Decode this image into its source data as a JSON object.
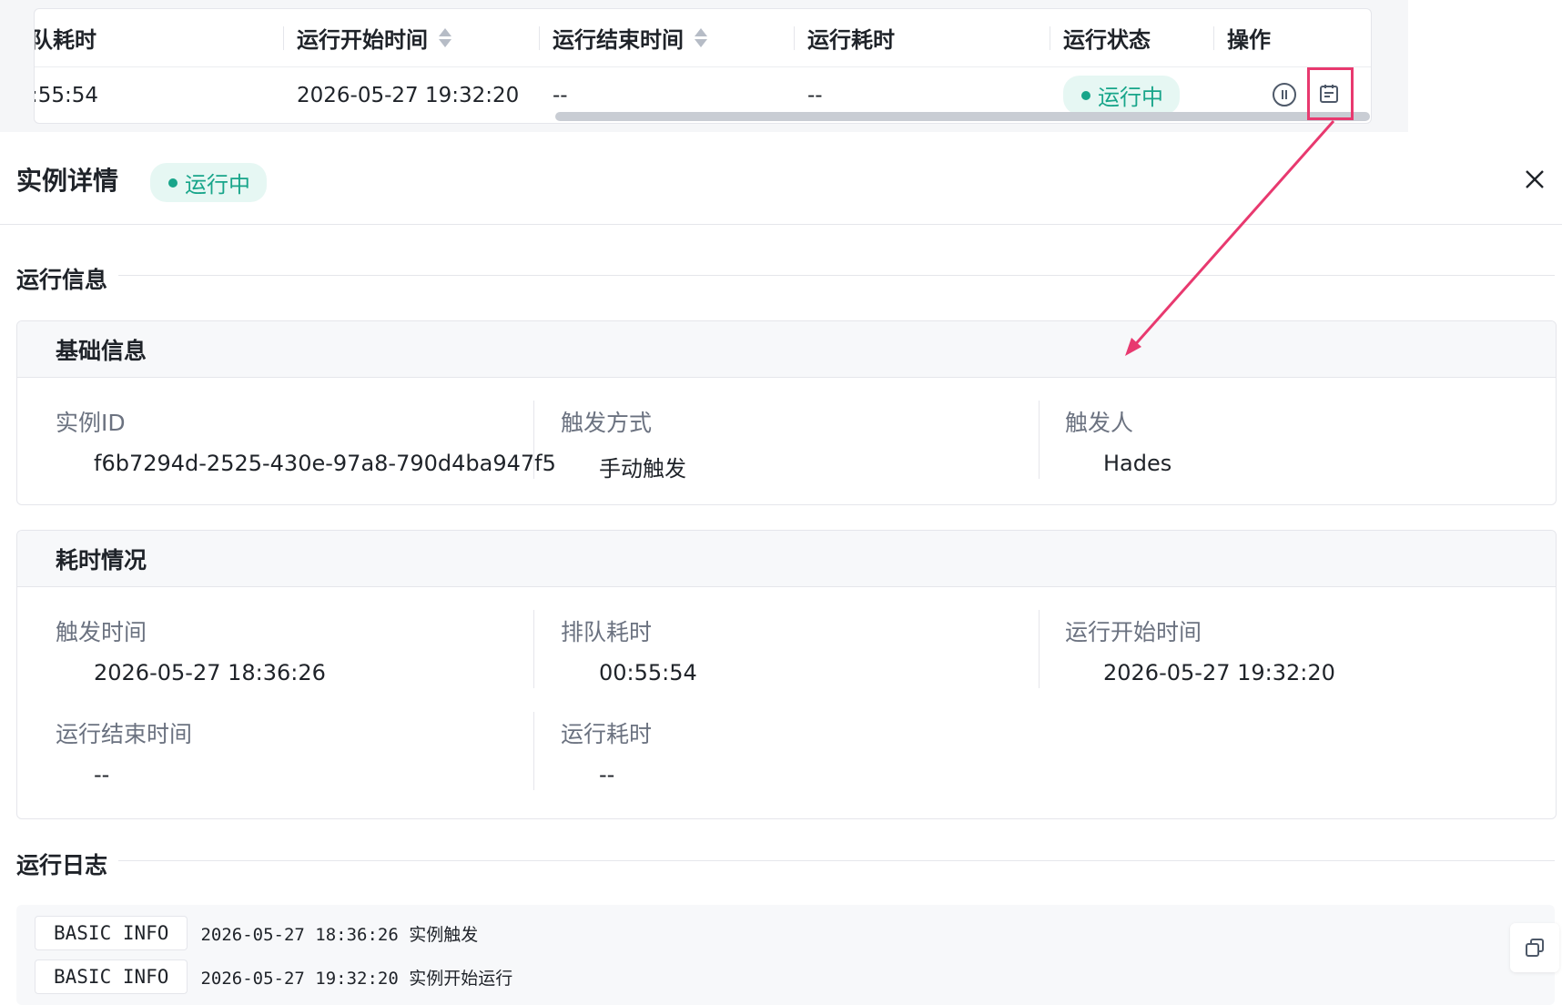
{
  "table": {
    "headers": {
      "queue_time": "队耗时",
      "run_start_time": "运行开始时间",
      "run_end_time": "运行结束时间",
      "run_duration": "运行耗时",
      "run_status": "运行状态",
      "actions": "操作"
    },
    "row": {
      "queue_time": ":55:54",
      "run_start_time": "2026-05-27 19:32:20",
      "run_end_time": "--",
      "run_duration": "--",
      "run_status": "运行中"
    },
    "action_icons": [
      "pause-icon",
      "detail-icon"
    ]
  },
  "drawer": {
    "title": "实例详情",
    "status": "运行中",
    "run_info_title": "运行信息",
    "basic": {
      "title": "基础信息",
      "instance_id_label": "实例ID",
      "instance_id_value": "f6b7294d-2525-430e-97a8-790d4ba947f5",
      "trigger_method_label": "触发方式",
      "trigger_method_value": "手动触发",
      "trigger_user_label": "触发人",
      "trigger_user_value": "Hades"
    },
    "timing": {
      "title": "耗时情况",
      "trigger_time_label": "触发时间",
      "trigger_time_value": "2026-05-27 18:36:26",
      "queue_time_label": "排队耗时",
      "queue_time_value": "00:55:54",
      "run_start_label": "运行开始时间",
      "run_start_value": "2026-05-27 19:32:20",
      "run_end_label": "运行结束时间",
      "run_end_value": "--",
      "run_duration_label": "运行耗时",
      "run_duration_value": "--"
    },
    "log": {
      "title": "运行日志",
      "entries": [
        {
          "tag": "BASIC INFO",
          "text": "2026-05-27 18:36:26 实例触发"
        },
        {
          "tag": "BASIC INFO",
          "text": "2026-05-27 19:32:20 实例开始运行"
        }
      ]
    }
  },
  "colors": {
    "status_green": "#18a58a",
    "status_bg": "#e6f7f3",
    "highlight": "#e8396f"
  }
}
